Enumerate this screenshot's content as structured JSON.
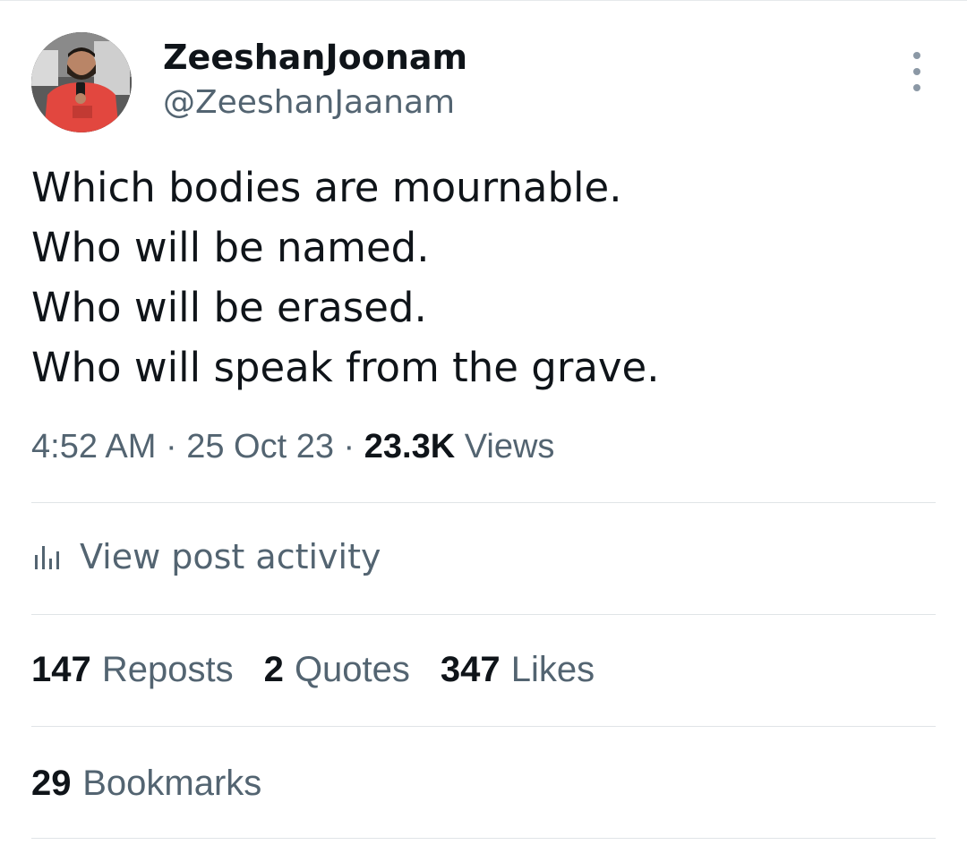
{
  "author": {
    "display_name": "ZeeshanJoonam",
    "handle": "@ZeeshanJaanam",
    "avatar_icon": "profile-photo"
  },
  "post": {
    "lines": [
      "Which bodies are mournable.",
      "Who will be named.",
      "Who will be erased.",
      "Who will speak from the grave."
    ]
  },
  "meta": {
    "time": "4:52 AM",
    "separator": "·",
    "date": "25 Oct 23",
    "views_count": "23.3K",
    "views_label": "Views"
  },
  "activity": {
    "icon": "bar-chart-icon",
    "label": "View post activity"
  },
  "stats": {
    "reposts_count": "147",
    "reposts_label": "Reposts",
    "quotes_count": "2",
    "quotes_label": "Quotes",
    "likes_count": "347",
    "likes_label": "Likes",
    "bookmarks_count": "29",
    "bookmarks_label": "Bookmarks"
  },
  "colors": {
    "text_primary": "#0f1419",
    "text_secondary": "#536471",
    "divider": "#e0e4e7"
  }
}
